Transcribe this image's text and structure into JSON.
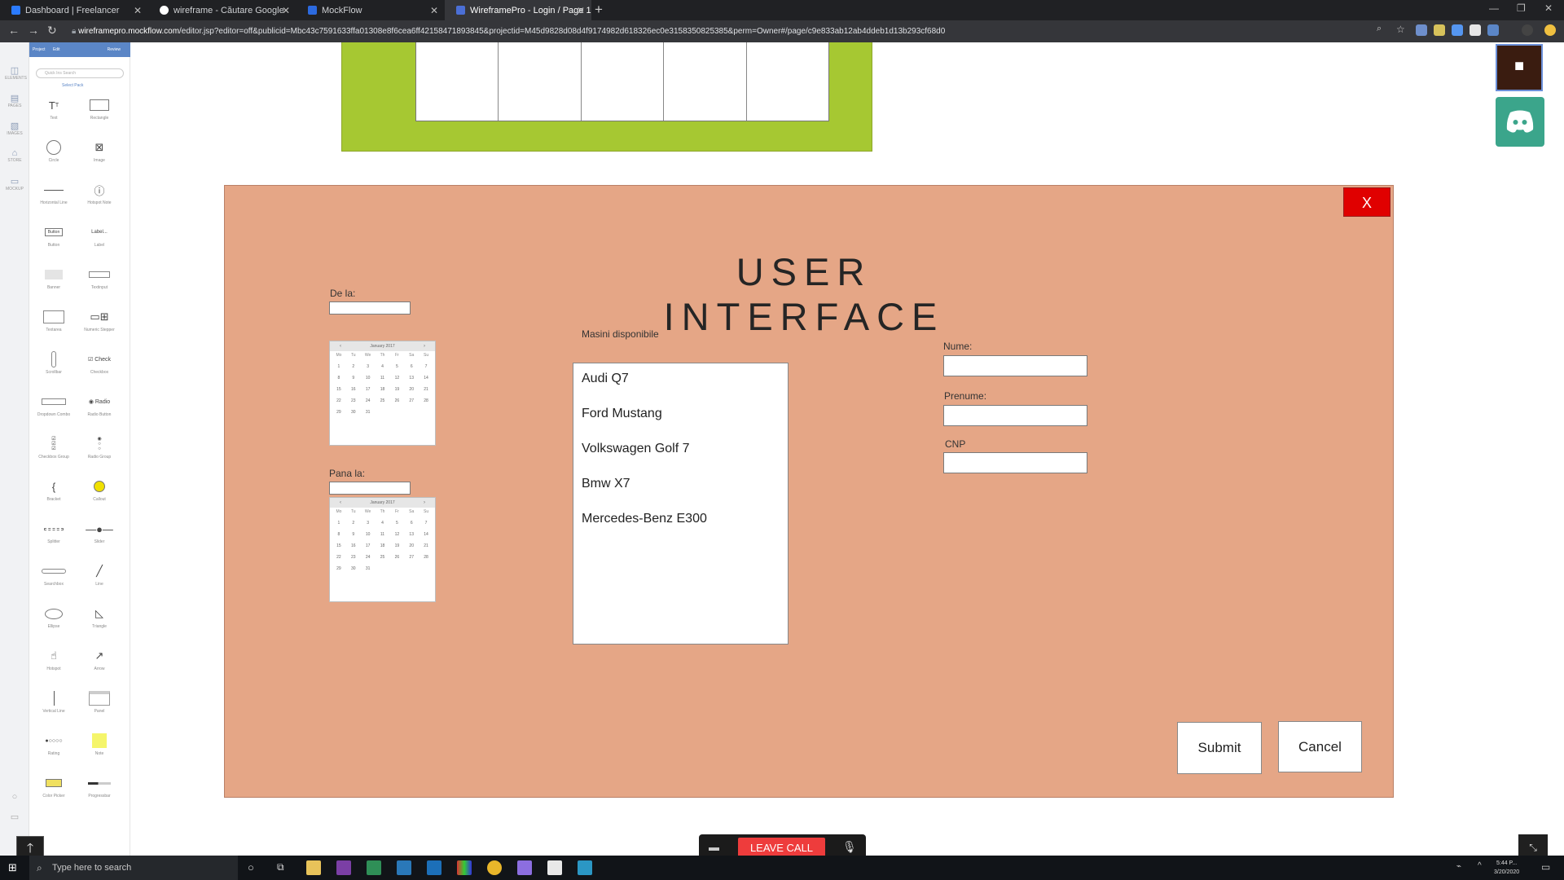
{
  "browser": {
    "tabs": [
      {
        "title": "Dashboard | Freelancer",
        "color": "#2b7bff"
      },
      {
        "title": "wireframe - Căutare Google",
        "color": "#ffffff"
      },
      {
        "title": "MockFlow",
        "color": "#2c6adf"
      },
      {
        "title": "WireframePro - Login / Page 1",
        "color": "#4b6fd6"
      }
    ],
    "url_host": "wireframepro.mockflow.com",
    "url_path": "/editor.jsp?editor=off&publicid=Mbc43c7591633ffa01308e8f6cea6ff42158471893845&projectid=M45d9828d08d4f9174982d618326ec0e3158350825385&perm=Owner#/page/c9e833ab12ab4ddeb1d13b293cf68d0"
  },
  "editor": {
    "header_project": "Project",
    "header_edit": "Edit",
    "header_review": "Review",
    "search_placeholder": "Quick Ins Search",
    "select_pack": "Select Pack",
    "rail": [
      "ELEMENTS",
      "PAGES",
      "IMAGES",
      "STORE",
      "MOCKUP"
    ],
    "components": [
      [
        "Text",
        "Rectangle"
      ],
      [
        "Circle",
        "Image"
      ],
      [
        "Horizontal Line",
        "Hotspot Note"
      ],
      [
        "Button",
        "Label"
      ],
      [
        "Banner",
        "Textinput"
      ],
      [
        "Textarea",
        "Numeric Stepper"
      ],
      [
        "Scrollbar",
        "Checkbox"
      ],
      [
        "Dropdown Combo",
        "Radio Button"
      ],
      [
        "Checkbox Group",
        "Radio Group"
      ],
      [
        "Bracket",
        "Callout"
      ],
      [
        "Splitter",
        "Slider"
      ],
      [
        "Searchbox",
        "Line"
      ],
      [
        "Ellipse",
        "Triangle"
      ],
      [
        "Hotspot",
        "Arrow"
      ],
      [
        "Vertical Line",
        "Panel"
      ],
      [
        "Rating",
        "Note"
      ],
      [
        "Color Picker",
        "Progressbar"
      ]
    ]
  },
  "form": {
    "title": "USER INTERFACE",
    "close_label": "X",
    "from_label": "De la:",
    "to_label": "Pana la:",
    "calendar_month": "January 2017",
    "weekdays": [
      "Mo",
      "Tu",
      "We",
      "Th",
      "Fr",
      "Sa",
      "Su"
    ],
    "days": [
      "1",
      "2",
      "3",
      "4",
      "5",
      "6",
      "7",
      "8",
      "9",
      "10",
      "11",
      "12",
      "13",
      "14",
      "15",
      "16",
      "17",
      "18",
      "19",
      "20",
      "21",
      "22",
      "23",
      "24",
      "25",
      "26",
      "27",
      "28",
      "29",
      "30",
      "31"
    ],
    "cars_label": "Masini disponibile",
    "cars": [
      "Audi Q7",
      "Ford Mustang",
      "Volkswagen Golf 7",
      "Bmw X7",
      "Mercedes-Benz E300"
    ],
    "nume_label": "Nume:",
    "prenume_label": "Prenume:",
    "cnp_label": "CNP",
    "submit_label": "Submit",
    "cancel_label": "Cancel"
  },
  "call": {
    "leave_label": "LEAVE CALL"
  },
  "taskbar": {
    "search_placeholder": "Type here to search",
    "time": "5:44 P...",
    "date": "3/20/2020"
  },
  "colors": {
    "modal_bg": "#e5a686",
    "green_frame": "#a6c832",
    "close_red": "#e00000",
    "leave_red": "#ee3c3c",
    "discord_green": "#3ba58b"
  }
}
